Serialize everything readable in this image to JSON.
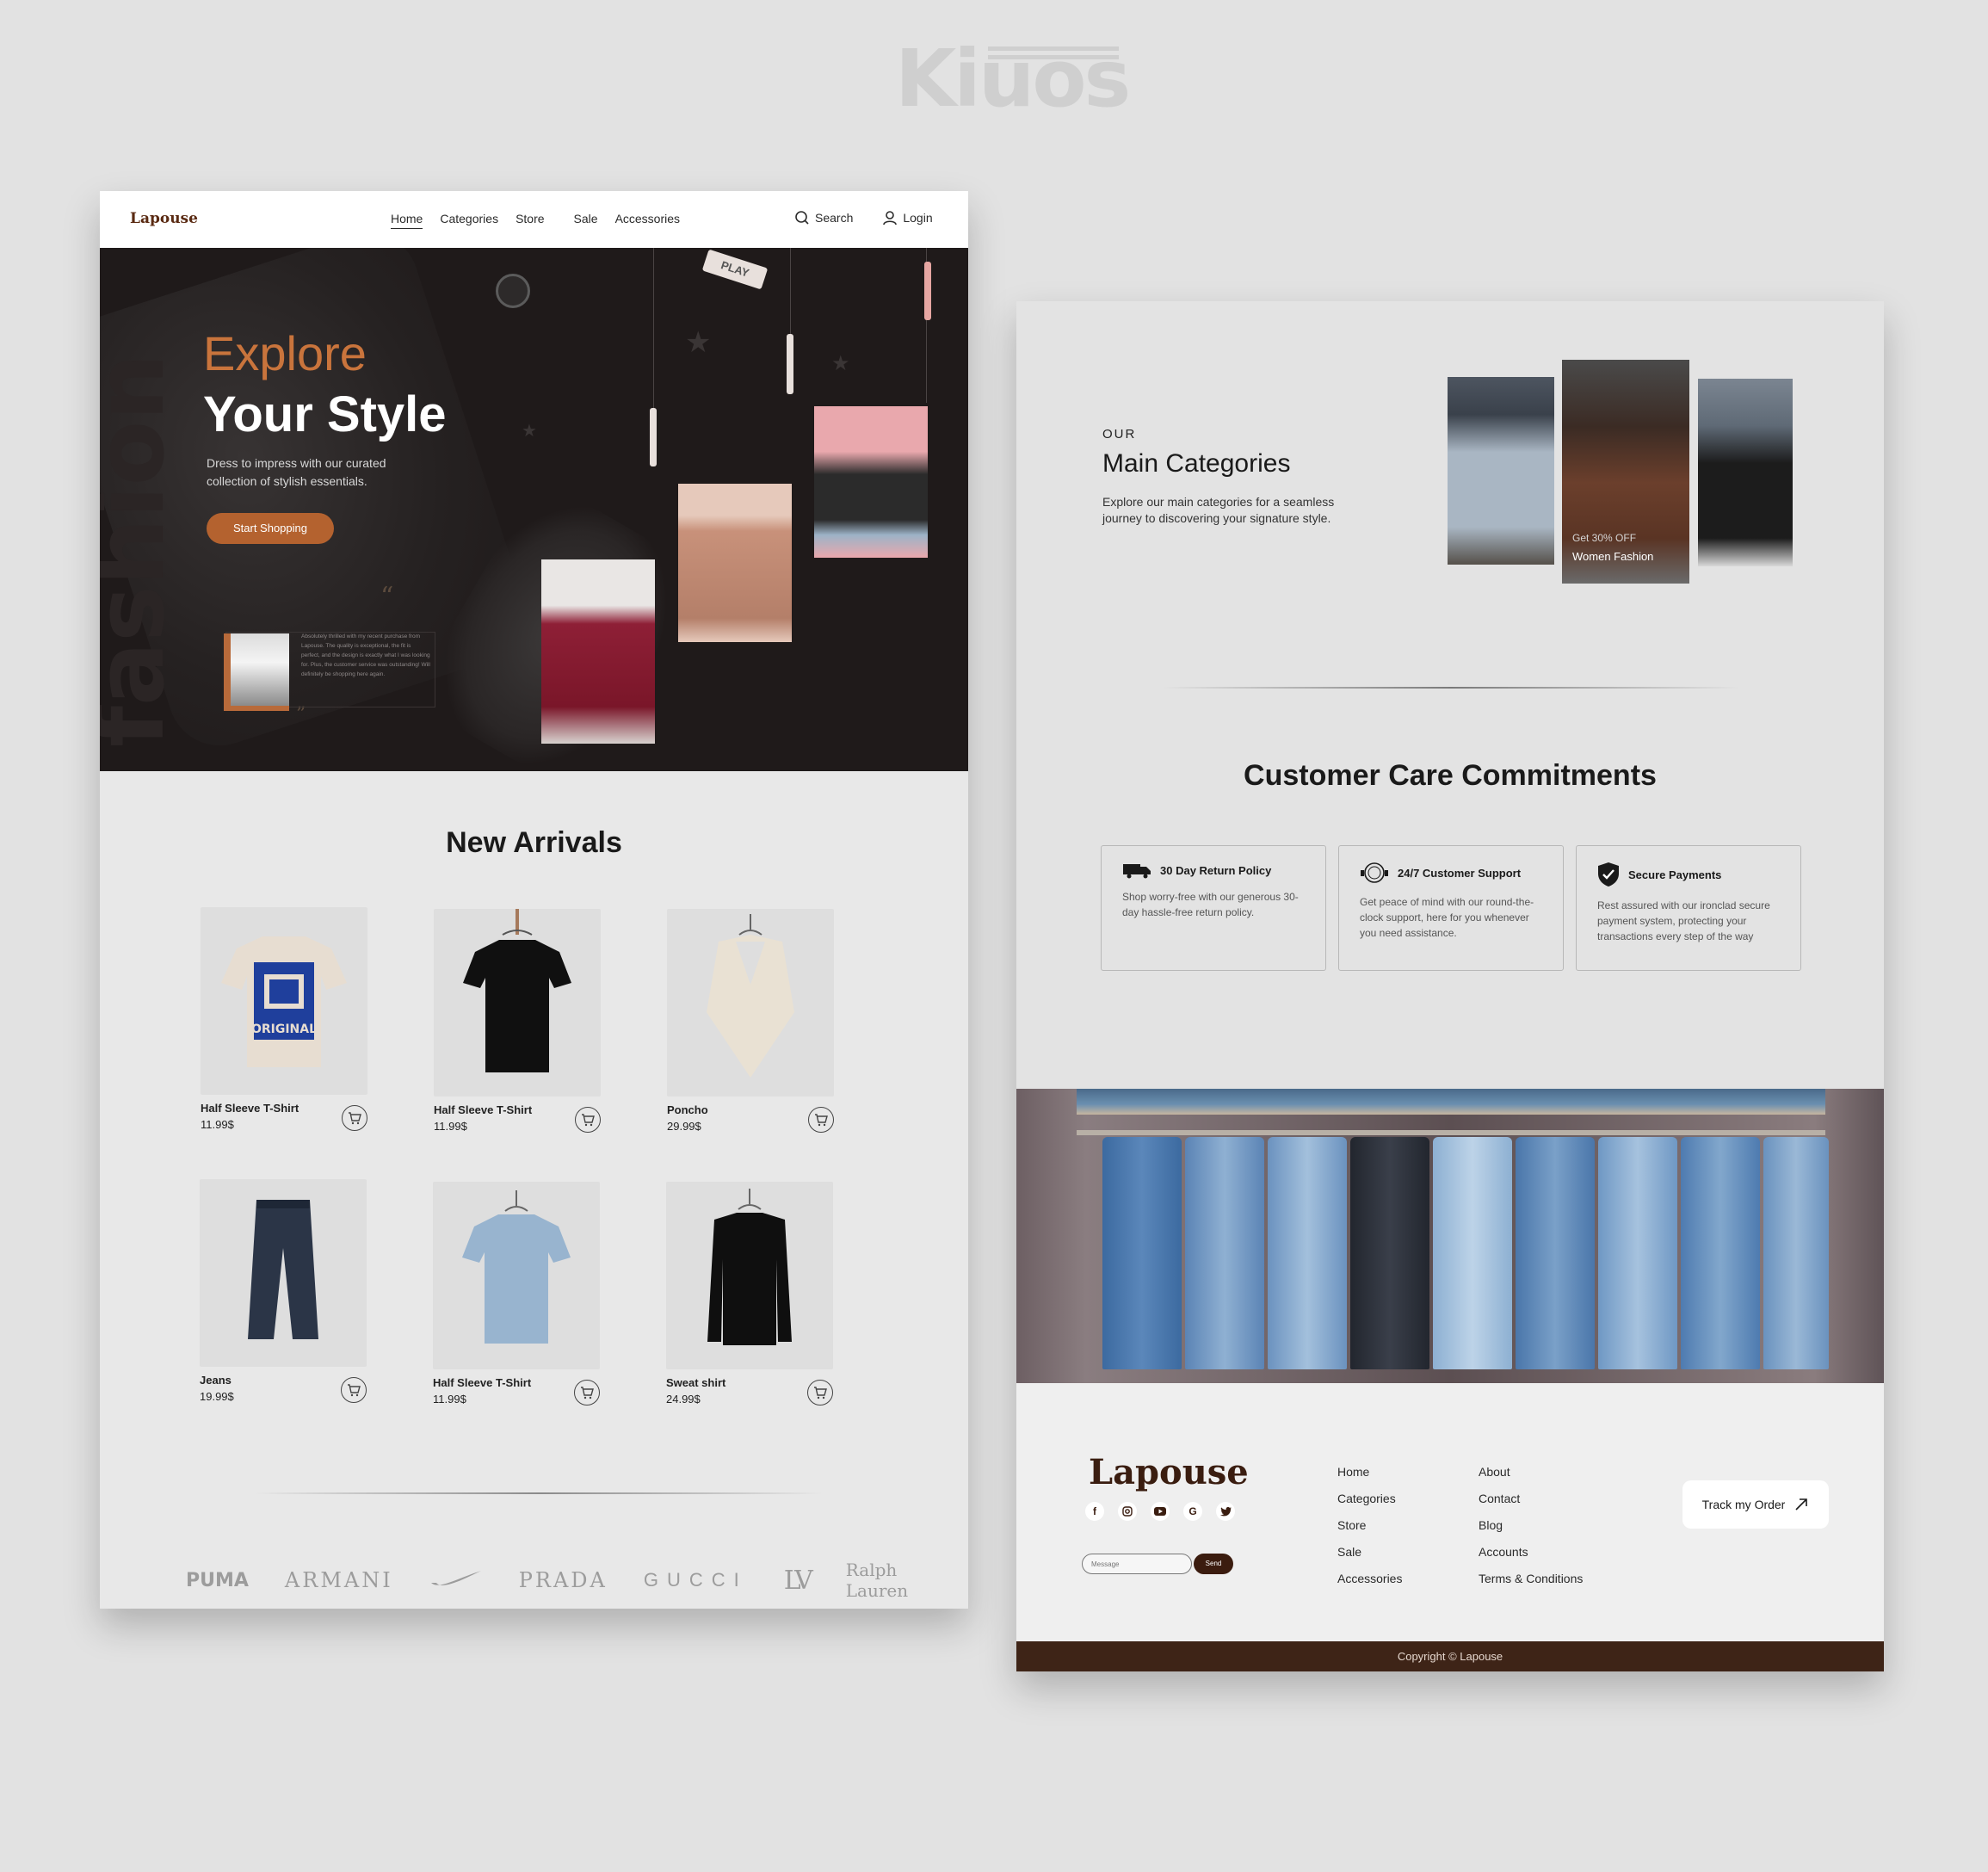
{
  "watermark": {
    "text": "Kiuos"
  },
  "left_page": {
    "nav": {
      "brand": "Lapouse",
      "links": [
        "Home",
        "Categories",
        "Store",
        "Sale",
        "Accessories"
      ],
      "search_label": "Search",
      "login_label": "Login"
    },
    "hero": {
      "bg_word": "fashion",
      "title_line1": "Explore",
      "title_line2": "Your Style",
      "subtitle": "Dress to impress with our curated collection of stylish essentials.",
      "cta_label": "Start Shopping",
      "tag_text": "PLAY",
      "review_text": "Absolutely thrilled with my recent purchase from Lapouse. The quality is exceptional, the fit is perfect, and the design is exactly what I was looking for. Plus, the customer service was outstanding! Will definitely be shopping here again."
    },
    "new_arrivals": {
      "title": "New Arrivals",
      "products": [
        {
          "name": "Half Sleeve T-Shirt",
          "price": "11.99$",
          "icon": "graphic-tshirt"
        },
        {
          "name": "Half Sleeve T-Shirt",
          "price": "11.99$",
          "icon": "black-tshirt"
        },
        {
          "name": "Poncho",
          "price": "29.99$",
          "icon": "poncho"
        },
        {
          "name": "Jeans",
          "price": "19.99$",
          "icon": "jeans"
        },
        {
          "name": "Half Sleeve T-Shirt",
          "price": "11.99$",
          "icon": "blue-tshirt"
        },
        {
          "name": "Sweat shirt",
          "price": "24.99$",
          "icon": "sweatshirt"
        }
      ],
      "tshirt_print": "ORIGINAL"
    },
    "brands": [
      "PUMA",
      "ARMANI",
      "NIKE",
      "PRADA",
      "GUCCI",
      "LV",
      "Ralph Lauren"
    ]
  },
  "right_page": {
    "categories": {
      "overline": "OUR",
      "title": "Main Categories",
      "description": "Explore our main categories for a seamless journey to discovering your signature style.",
      "featured_offer": "Get 30% OFF",
      "featured_name": "Women Fashion"
    },
    "care": {
      "title": "Customer Care Commitments",
      "items": [
        {
          "title": "30 Day Return Policy",
          "body": "Shop worry-free with our generous 30-day hassle-free return policy.",
          "icon": "truck-icon"
        },
        {
          "title": "24/7 Customer Support",
          "body": "Get peace of mind with our round-the-clock support, here for you whenever you need assistance.",
          "icon": "support-24-7-icon"
        },
        {
          "title": "Secure Payments",
          "body": "Rest assured with our ironclad secure payment system, protecting your transactions every step of the way",
          "icon": "shield-check-icon"
        }
      ]
    },
    "footer": {
      "brand": "Lapouse",
      "message_placeholder": "Message",
      "send_label": "Send",
      "col1": [
        "Home",
        "Categories",
        "Store",
        "Sale",
        "Accessories"
      ],
      "col2": [
        "About",
        "Contact",
        "Blog",
        "Accounts",
        "Terms & Conditions"
      ],
      "track_label": "Track my Order",
      "copyright": "Copyright © Lapouse",
      "socials": [
        "facebook",
        "instagram",
        "youtube",
        "google",
        "twitter"
      ]
    }
  },
  "colors": {
    "accent": "#b4622f",
    "brand_dark": "#3e2417",
    "hero_bg": "#1f1a1a"
  }
}
